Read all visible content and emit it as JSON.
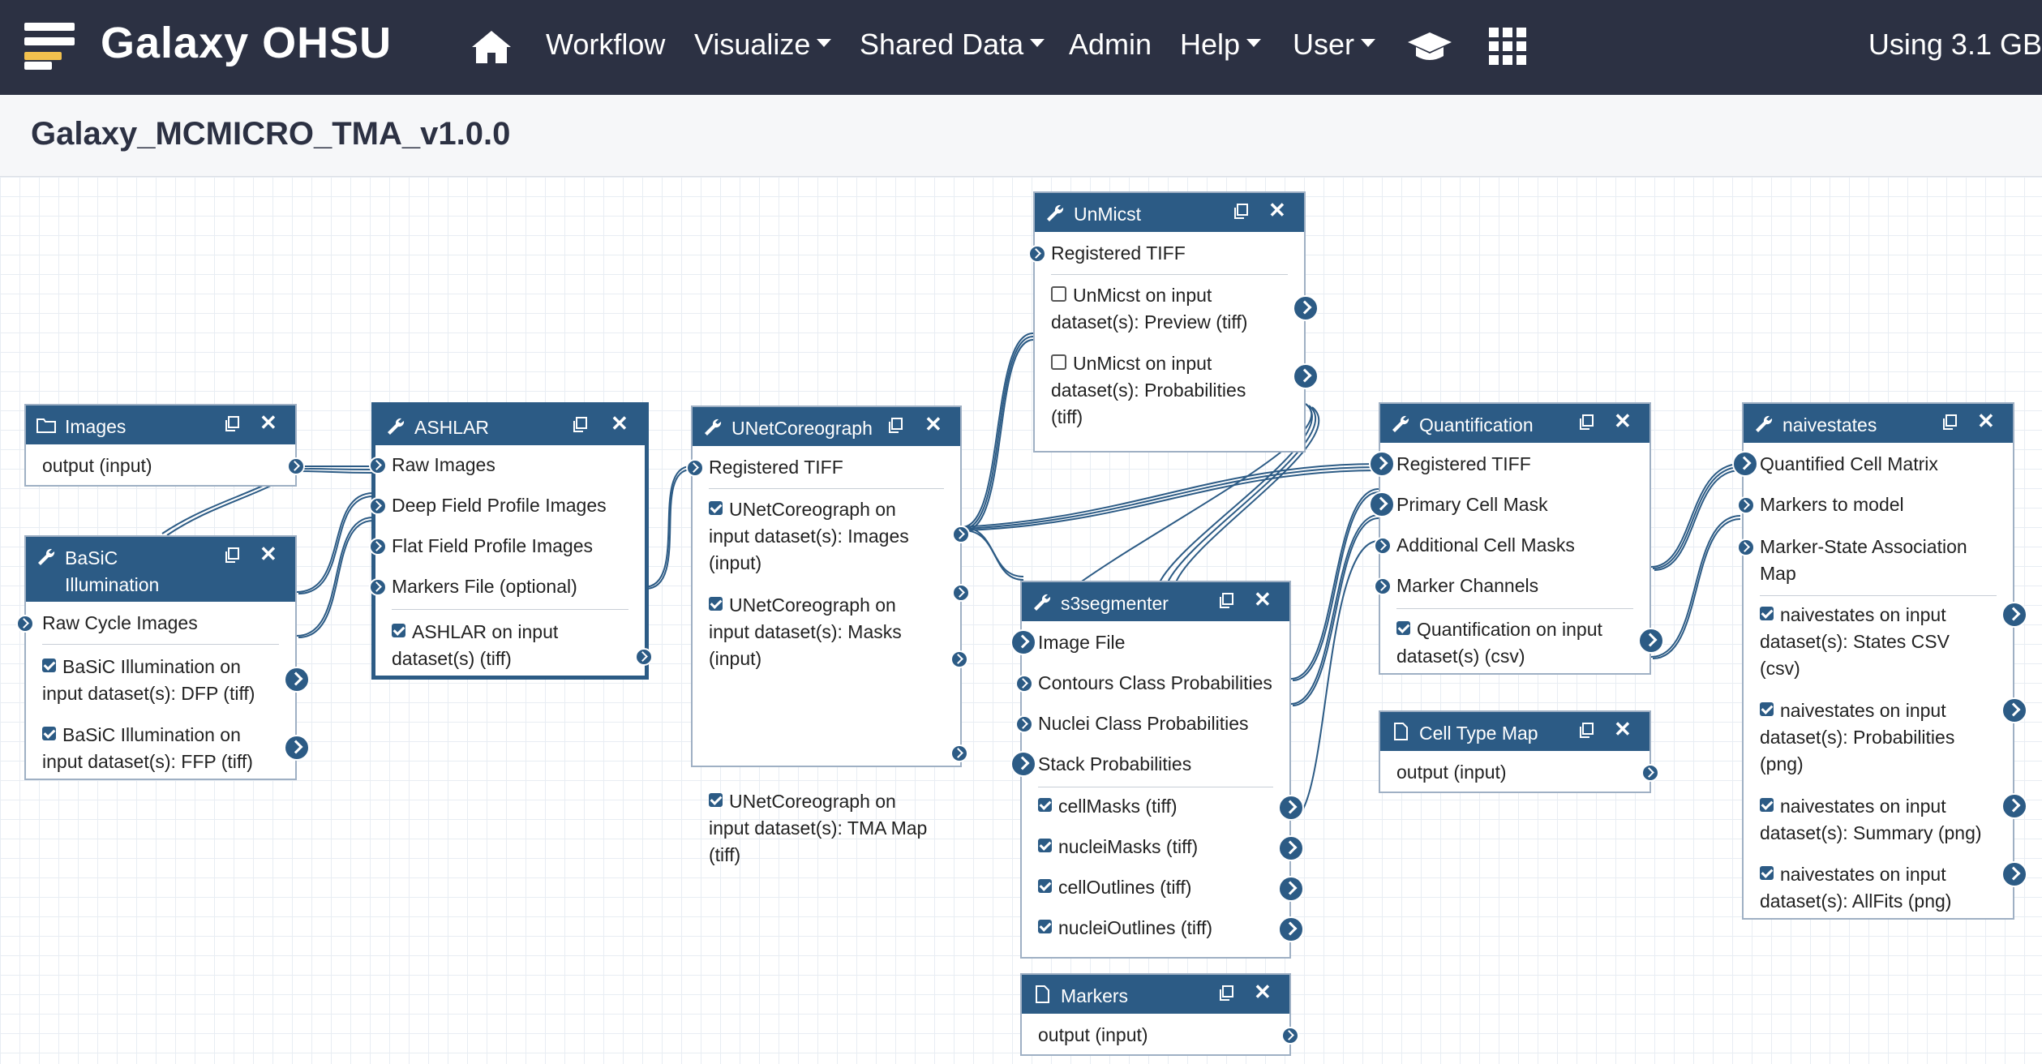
{
  "navbar": {
    "brand": "Galaxy OHSU",
    "items": [
      "Workflow",
      "Visualize",
      "Shared Data",
      "Admin",
      "Help",
      "User"
    ],
    "usage": "Using 3.1 GB"
  },
  "workflow": {
    "title": "Galaxy_MCMICRO_TMA_v1.0.0"
  },
  "nodes": {
    "images": {
      "title": "Images",
      "outputs": [
        "output (input)"
      ]
    },
    "basic": {
      "title": "BaSiC Illumination",
      "title_lines": [
        "BaSiC",
        "Illumination"
      ],
      "inputs": [
        "Raw Cycle Images"
      ],
      "outputs": [
        [
          "BaSiC Illumination on",
          "input dataset(s): DFP (tiff)"
        ],
        [
          "BaSiC Illumination on",
          "input dataset(s): FFP (tiff)"
        ]
      ]
    },
    "ashlar": {
      "title": "ASHLAR",
      "inputs": [
        "Raw Images",
        "Deep Field Profile Images",
        "Flat Field Profile Images",
        "Markers File (optional)"
      ],
      "outputs": [
        [
          "ASHLAR on input",
          "dataset(s) (tiff)"
        ]
      ]
    },
    "unetcoreograph": {
      "title": "UNetCoreograph",
      "inputs": [
        "Registered TIFF"
      ],
      "outputs": [
        [
          "UNetCoreograph on",
          "input dataset(s): Images",
          "(input)"
        ],
        [
          "UNetCoreograph on",
          "input dataset(s): Masks",
          "(input)"
        ],
        [
          "UNetCoreograph on",
          "input dataset(s): TMA Map",
          "(tiff)"
        ]
      ]
    },
    "unmicst": {
      "title": "UnMicst",
      "inputs": [
        "Registered TIFF"
      ],
      "outputs": [
        [
          "UnMicst on input",
          "dataset(s): Preview (tiff)"
        ],
        [
          "UnMicst on input",
          "dataset(s): Probabilities",
          "(tiff)"
        ]
      ]
    },
    "s3segmenter": {
      "title": "s3segmenter",
      "inputs": [
        "Image File",
        "Contours Class Probabilities",
        "Nuclei Class Probabilities",
        "Stack Probabilities"
      ],
      "outputs": [
        "cellMasks (tiff)",
        "nucleiMasks (tiff)",
        "cellOutlines (tiff)",
        "nucleiOutlines (tiff)"
      ]
    },
    "markers": {
      "title": "Markers",
      "outputs": [
        "output (input)"
      ]
    },
    "quantification": {
      "title": "Quantification",
      "inputs": [
        "Registered TIFF",
        "Primary Cell Mask",
        "Additional Cell Masks",
        "Marker Channels"
      ],
      "outputs": [
        [
          "Quantification on input",
          "dataset(s) (csv)"
        ]
      ]
    },
    "celltypemap": {
      "title": "Cell Type Map",
      "outputs": [
        "output (input)"
      ]
    },
    "naivestates": {
      "title": "naivestates",
      "inputs": [
        "Quantified Cell Matrix",
        "Markers to model",
        "Marker-State Association Map"
      ],
      "input_lines": [
        [
          "Quantified Cell Matrix"
        ],
        [
          "Markers to model"
        ],
        [
          "Marker-State Association",
          "Map"
        ]
      ],
      "outputs": [
        [
          "naivestates on input",
          "dataset(s): States CSV",
          "(csv)"
        ],
        [
          "naivestates on input",
          "dataset(s): Probabilities",
          "(png)"
        ],
        [
          "naivestates on input",
          "dataset(s): Summary (png)"
        ],
        [
          "naivestates on input",
          "dataset(s): AllFits (png)"
        ]
      ]
    }
  },
  "colors": {
    "navbar": "#2c3143",
    "node_header": "#2c5b85",
    "wire": "#2c5b85"
  },
  "icons": {
    "tool": "wrench-icon",
    "input_dataset": "folder-icon",
    "input_file": "file-icon",
    "copy": "copy-icon",
    "close": "close-icon"
  }
}
